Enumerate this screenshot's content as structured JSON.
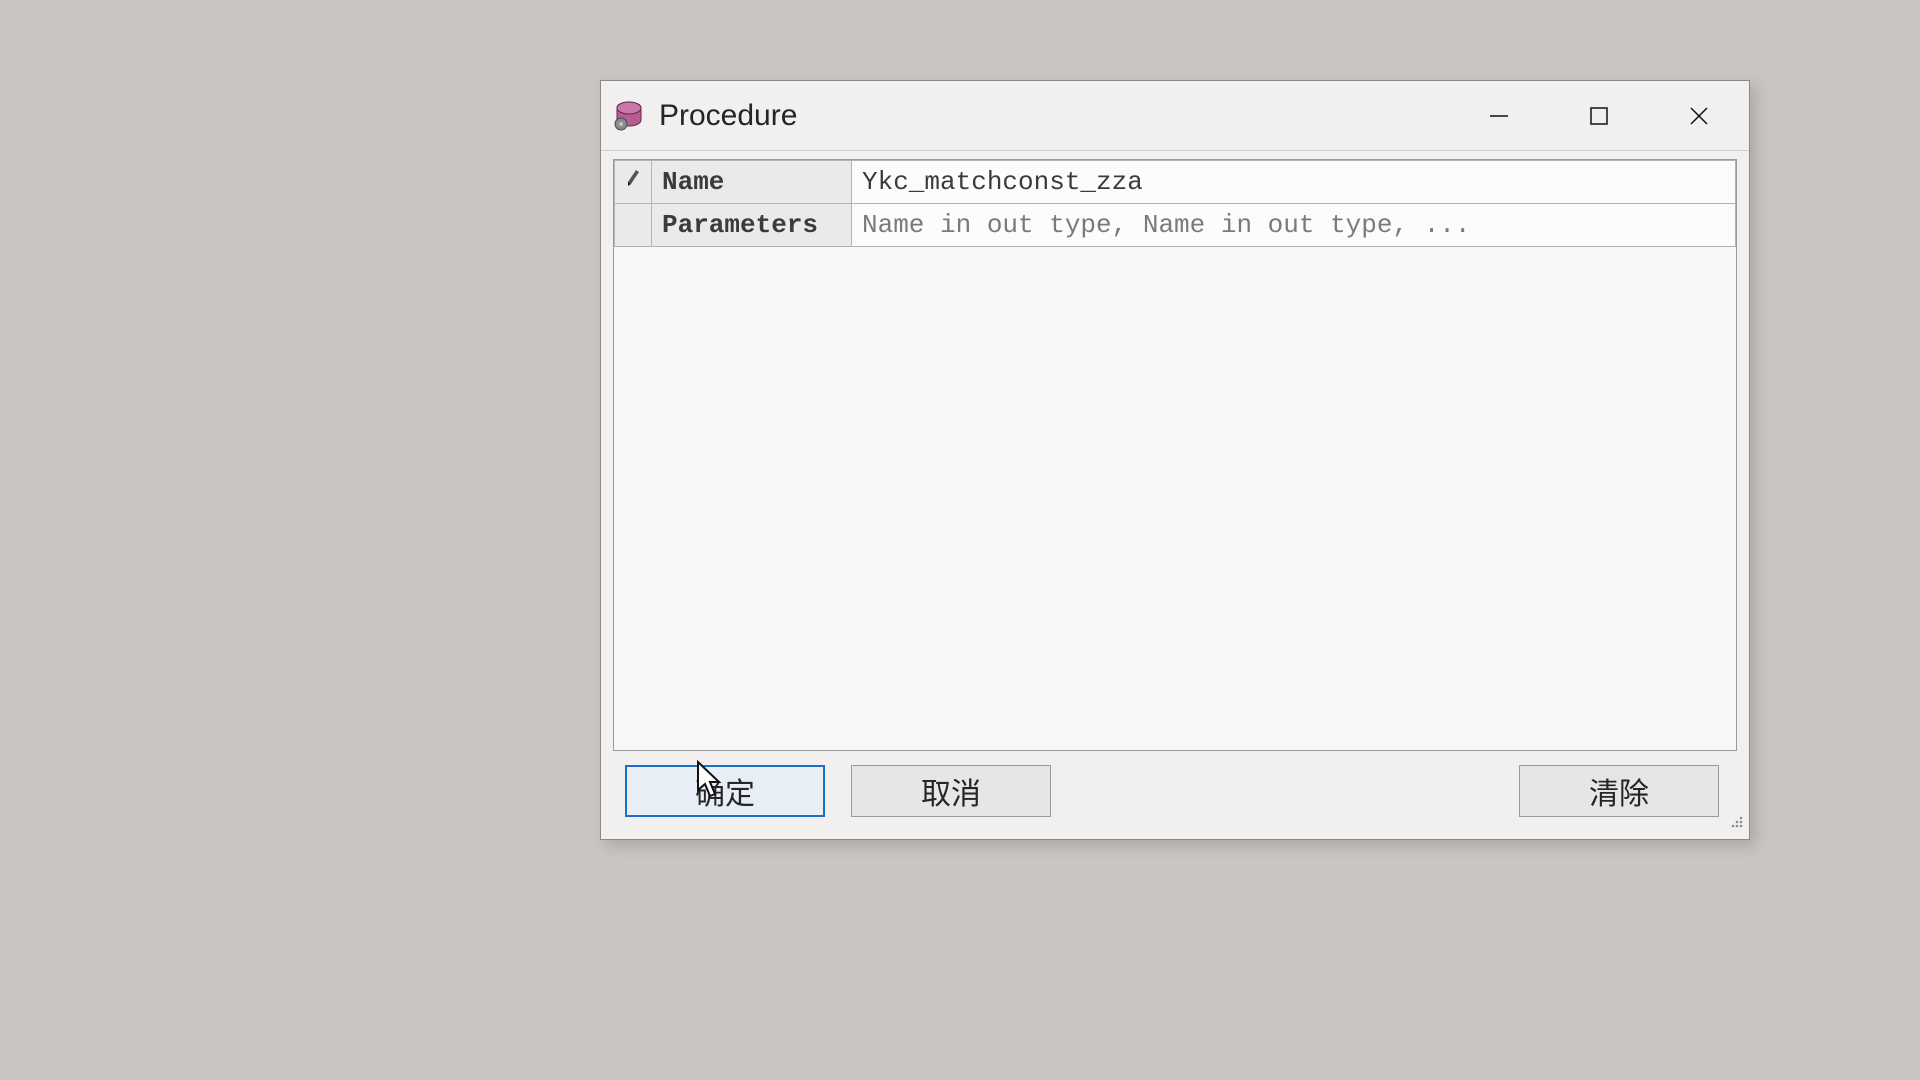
{
  "dialog": {
    "title": "Procedure",
    "grid": {
      "rows": [
        {
          "marker": "pencil",
          "label": "Name",
          "value": "Ykc_matchconst_zza",
          "editable": true
        },
        {
          "marker": "",
          "label": "Parameters",
          "value": "Name in out type, Name in out type, ...",
          "editable": false
        }
      ]
    },
    "buttons": {
      "ok": "确定",
      "cancel": "取消",
      "clear": "清除"
    }
  }
}
